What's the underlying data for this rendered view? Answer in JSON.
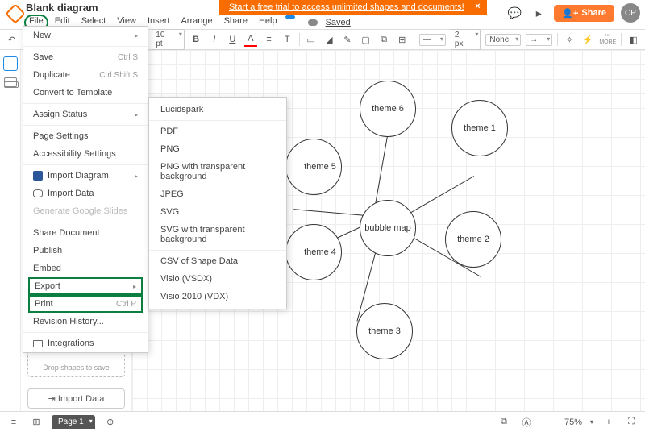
{
  "banner": {
    "text": "Start a free trial to access unlimited shapes and documents!"
  },
  "doc": {
    "title": "Blank diagram"
  },
  "menubar": [
    "File",
    "Edit",
    "Select",
    "View",
    "Insert",
    "Arrange",
    "Share",
    "Help"
  ],
  "saved": "Saved",
  "share_label": "Share",
  "avatar": "CP",
  "toolbar": {
    "font_size": "10 pt",
    "stroke_w": "2 px",
    "line_style": "None"
  },
  "file_menu": {
    "new": "New",
    "save": "Save",
    "save_sc": "Ctrl S",
    "dup": "Duplicate",
    "dup_sc": "Ctrl Shift S",
    "convert": "Convert to Template",
    "assign": "Assign Status",
    "page": "Page Settings",
    "a11y": "Accessibility Settings",
    "import_diag": "Import Diagram",
    "import_data": "Import Data",
    "gslides": "Generate Google Slides",
    "share_doc": "Share Document",
    "publish": "Publish",
    "embed": "Embed",
    "export": "Export",
    "print": "Print",
    "print_sc": "Ctrl P",
    "rev": "Revision History...",
    "integ": "Integrations"
  },
  "export_menu": [
    "Lucidspark",
    "PDF",
    "PNG",
    "PNG with transparent background",
    "JPEG",
    "SVG",
    "SVG with transparent background",
    "CSV of Shape Data",
    "Visio (VSDX)",
    "Visio 2010 (VDX)"
  ],
  "sidebar": {
    "drop": "Drop shapes to save",
    "import": "Import Data"
  },
  "diagram": {
    "center": "bubble map",
    "nodes": [
      "theme 1",
      "theme 2",
      "theme 3",
      "theme 4",
      "theme 5",
      "theme 6"
    ]
  },
  "bottom": {
    "page": "Page 1",
    "zoom": "75%"
  }
}
